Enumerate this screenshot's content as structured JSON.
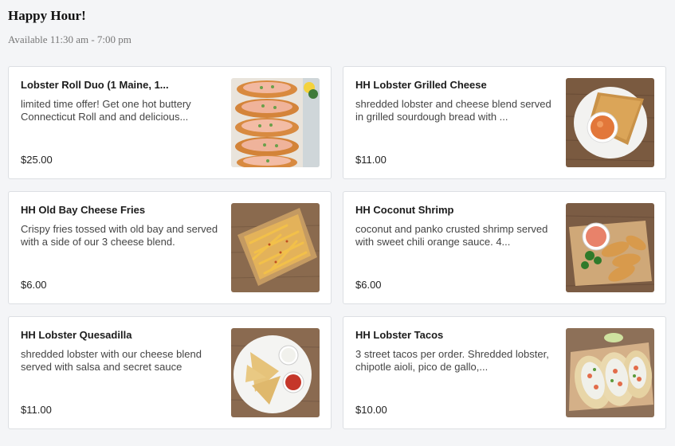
{
  "section": {
    "title": "Happy Hour!",
    "availability": "Available 11:30 am - 7:00 pm"
  },
  "items": [
    {
      "name": "Lobster Roll Duo (1 Maine, 1...",
      "description": "limited time offer! Get one hot buttery Connecticut Roll and and delicious...",
      "price": "$25.00",
      "image_icon": "lobster-roll-photo"
    },
    {
      "name": "HH Lobster Grilled Cheese",
      "description": "shredded lobster and cheese blend served in grilled sourdough bread with ...",
      "price": "$11.00",
      "image_icon": "grilled-cheese-photo"
    },
    {
      "name": "HH Old Bay Cheese Fries",
      "description": "Crispy fries tossed with old bay and served with a side of our 3 cheese blend.",
      "price": "$6.00",
      "image_icon": "cheese-fries-photo"
    },
    {
      "name": "HH Coconut Shrimp",
      "description": "coconut and panko crusted shrimp served with sweet chili orange sauce. 4...",
      "price": "$6.00",
      "image_icon": "coconut-shrimp-photo"
    },
    {
      "name": "HH Lobster Quesadilla",
      "description": "shredded lobster with our cheese blend served with salsa and secret sauce",
      "price": "$11.00",
      "image_icon": "quesadilla-photo"
    },
    {
      "name": "HH Lobster Tacos",
      "description": "3 street tacos per order. Shredded lobster, chipotle aioli, pico de gallo,...",
      "price": "$10.00",
      "image_icon": "lobster-tacos-photo"
    }
  ]
}
